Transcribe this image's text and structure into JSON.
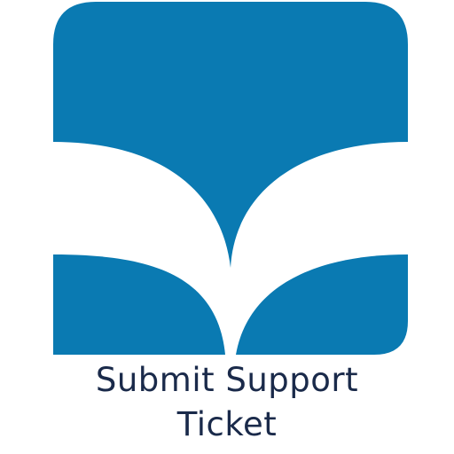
{
  "icon": {
    "name": "book-logo-icon",
    "color": "#0a7ab2"
  },
  "caption": {
    "line1": "Submit Support",
    "line2": "Ticket",
    "color": "#1a2a4a"
  }
}
